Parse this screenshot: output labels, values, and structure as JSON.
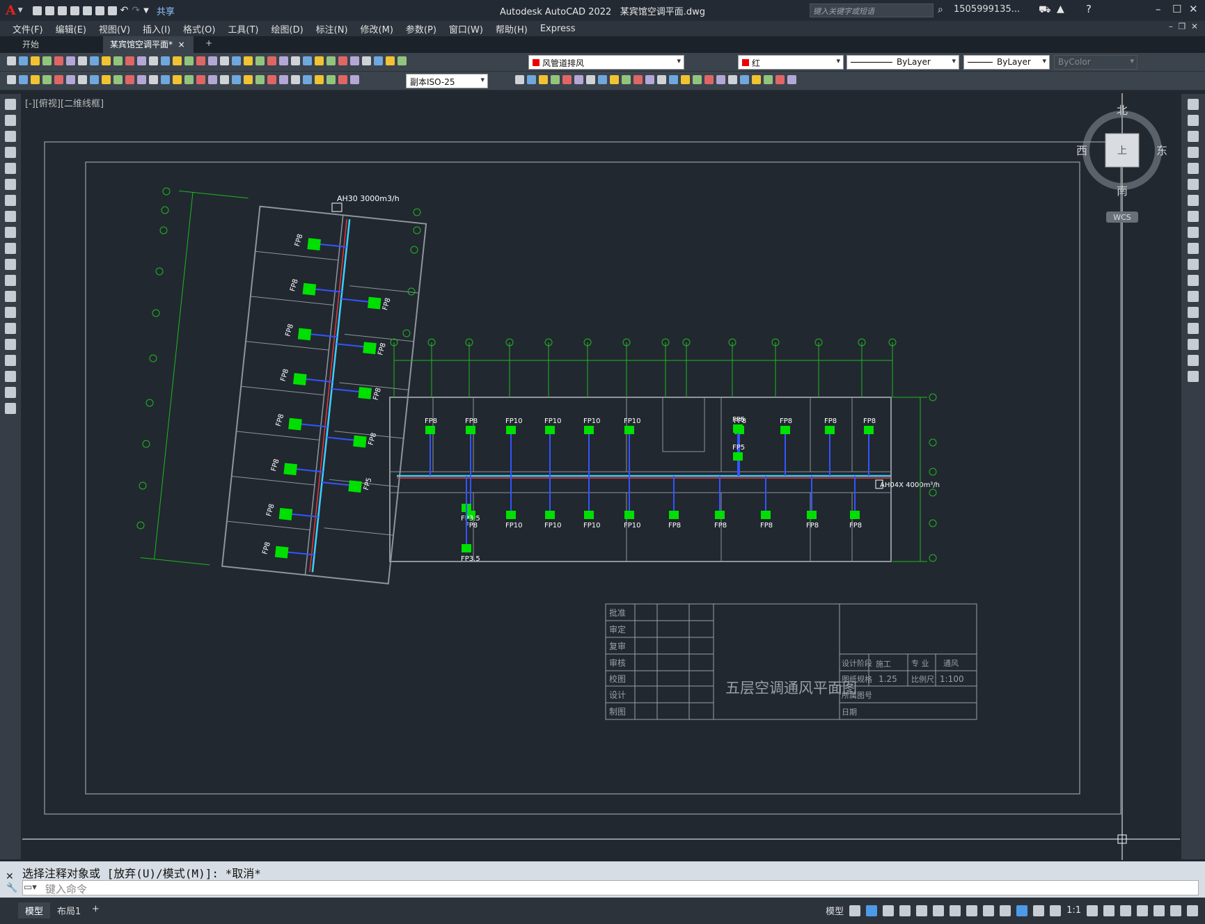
{
  "app": {
    "title": "Autodesk AutoCAD 2022",
    "file": "某宾馆空调平面.dwg",
    "share": "共享",
    "search_placeholder": "键入关键字或短语",
    "user": "1505999135..."
  },
  "menu": [
    "文件(F)",
    "编辑(E)",
    "视图(V)",
    "插入(I)",
    "格式(O)",
    "工具(T)",
    "绘图(D)",
    "标注(N)",
    "修改(M)",
    "参数(P)",
    "窗口(W)",
    "帮助(H)",
    "Express"
  ],
  "tabs": {
    "start": "开始",
    "active": "某宾馆空调平面*",
    "add": "+"
  },
  "properties": {
    "layer": "风管道排风",
    "color": "红",
    "linetype": "ByLayer",
    "lineweight": "ByLayer",
    "plotstyle": "ByColor",
    "dimstyle": "副本ISO-25"
  },
  "viewport": {
    "label": "[-][俯视][二维线框]"
  },
  "viewcube": {
    "north": "北",
    "south": "南",
    "east": "东",
    "west": "西",
    "face": "上",
    "wcs": "WCS"
  },
  "plan": {
    "ahu_top": "AH30   3000m3/h",
    "ahu_right": "AH04X 4000m³/h",
    "north_upper": [
      "FP10",
      "FP10",
      "FP10",
      "FP10"
    ],
    "fp8": "FP8",
    "fp10": "FP10",
    "fp5": "FP5",
    "fp35": "FP3.5"
  },
  "titleblock": {
    "rows": [
      "批准",
      "审定",
      "复审",
      "审核",
      "校图",
      "设计",
      "制图"
    ],
    "title": "五层空调通风平面图",
    "stage_label": "设计阶段",
    "stage": "施工",
    "major_label": "专  业",
    "major": "通风",
    "size_label": "图纸规格",
    "size": "1.25",
    "scale_label": "比例尺",
    "scale": "1:100",
    "dwgno_label": "所属图号",
    "date_label": "日期"
  },
  "command": {
    "history": "选择注释对象或 [放弃(U)/模式(M)]: *取消*",
    "placeholder": "键入命令"
  },
  "status": {
    "model": "模型",
    "layout1": "布局1",
    "add": "+",
    "mode": "模型",
    "scale": "1:1"
  }
}
